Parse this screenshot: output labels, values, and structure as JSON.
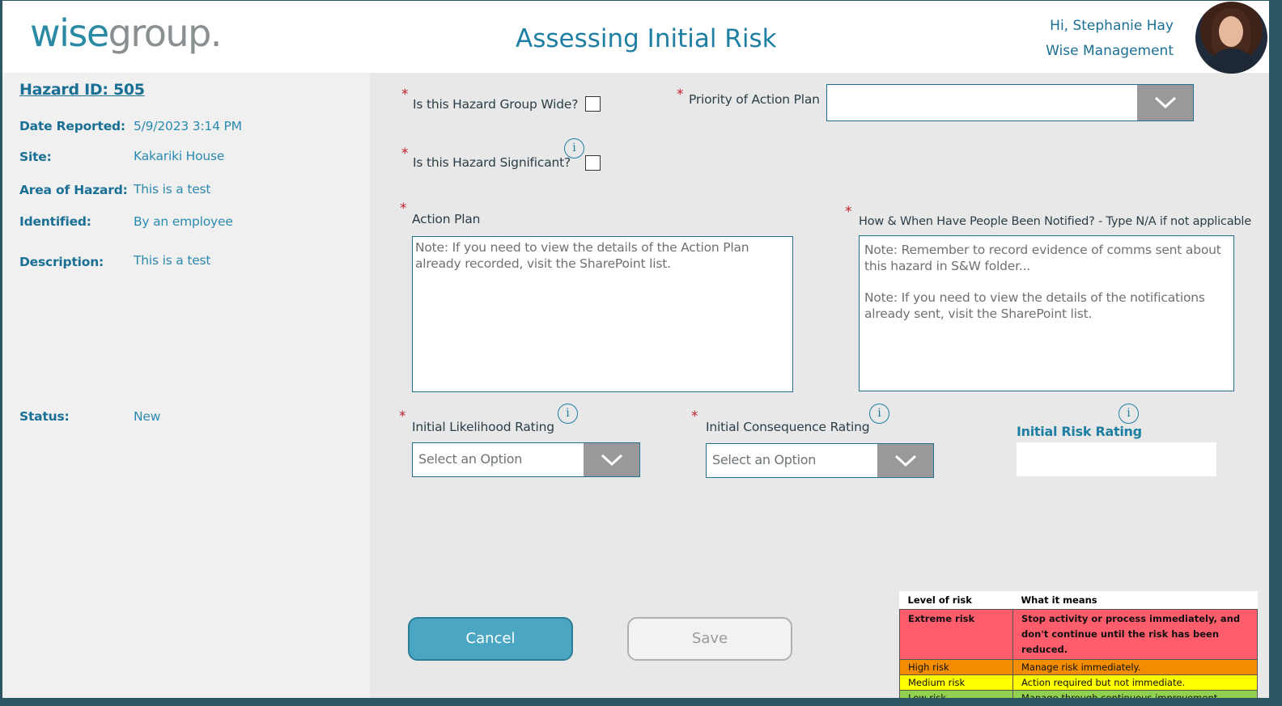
{
  "header": {
    "logo_part1": "wise",
    "logo_part2": "group.",
    "title": "Assessing Initial Risk",
    "greeting": "Hi, Stephanie Hay",
    "organization": "Wise Management"
  },
  "hazard": {
    "id_label": "Hazard ID:  505",
    "fields": [
      {
        "label": "Date Reported:",
        "value": "5/9/2023 3:14 PM"
      },
      {
        "label": "Site:",
        "value": "Kakariki House"
      },
      {
        "label": "Area of Hazard:",
        "value": "This is a test"
      },
      {
        "label": "Identified:",
        "value": "By an employee"
      },
      {
        "label": "Description:",
        "value": "This is a test"
      },
      {
        "label": "Status:",
        "value": "New"
      }
    ]
  },
  "form": {
    "required_marker": "*",
    "info_glyph": "i",
    "group_wide_label": "Is this Hazard Group Wide?",
    "group_wide_checked": false,
    "significant_label": "Is this Hazard Significant?",
    "significant_checked": false,
    "priority_label": "Priority of Action Plan",
    "priority_value": "",
    "action_plan_label": "Action Plan",
    "action_plan_note": "Note: If you need to view the details of the Action Plan already recorded, visit the SharePoint list.",
    "notified_label": "How & When Have People Been Notified? - Type N/A if not applicable",
    "notified_note1": "Note:  Remember to record evidence of comms sent about this hazard in S&W folder...",
    "notified_note2": "Note: If you need to view the details of the notifications already sent, visit the SharePoint list.",
    "likelihood_label": "Initial Likelihood Rating",
    "likelihood_placeholder": "Select an Option",
    "consequence_label": "Initial Consequence Rating",
    "consequence_placeholder": "Select an Option",
    "risk_rating_label": "Initial Risk Rating",
    "risk_rating_value": ""
  },
  "buttons": {
    "cancel": "Cancel",
    "save": "Save"
  },
  "risk_table": {
    "headers": [
      "Level of risk",
      "What it means"
    ],
    "rows": [
      {
        "level": "Extreme risk",
        "meaning": "Stop activity or process immediately, and don't continue until the risk has been reduced.",
        "color": "#ff5c6c"
      },
      {
        "level": "High risk",
        "meaning": "Manage risk immediately.",
        "color": "#f28c00"
      },
      {
        "level": "Medium risk",
        "meaning": "Action required but not immediate.",
        "color": "#ffff00"
      },
      {
        "level": "Low risk",
        "meaning": "Manage through continuous improvement.",
        "color": "#92d050"
      }
    ]
  },
  "colors": {
    "accent": "#1f7fa3",
    "required": "#c0202a",
    "dropdown_button": "#999999"
  },
  "icons": [
    "chevron-down-icon",
    "info-icon"
  ]
}
